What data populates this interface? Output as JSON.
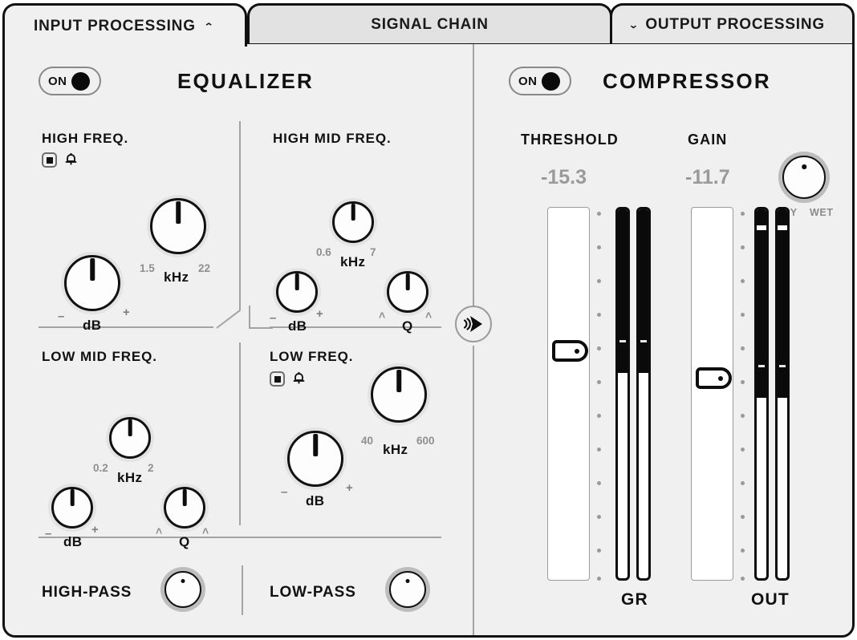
{
  "tabs": [
    {
      "id": "input",
      "label": "INPUT PROCESSING",
      "caret": "up",
      "state": "active"
    },
    {
      "id": "signal",
      "label": "SIGNAL CHAIN",
      "caret": "none",
      "state": "inactive"
    },
    {
      "id": "output",
      "label": "OUTPUT PROCESSING",
      "caret": "down",
      "state": "inactive"
    }
  ],
  "equalizer": {
    "title": "EQUALIZER",
    "power": {
      "label": "ON",
      "state": "on"
    },
    "bands": [
      {
        "id": "high",
        "label": "HIGH FREQ.",
        "filter_icons": [
          "shelf-icon",
          "bell-icon"
        ],
        "gain": {
          "unit": "dB",
          "minus": "–",
          "plus": "+"
        },
        "freq": {
          "unit": "kHz",
          "min": "1.5",
          "max": "22"
        }
      },
      {
        "id": "high-mid",
        "label": "HIGH MID FREQ.",
        "filter_icons": [],
        "gain": {
          "unit": "dB",
          "minus": "–",
          "plus": "+"
        },
        "freq": {
          "unit": "kHz",
          "min": "0.6",
          "max": "7"
        },
        "q": {
          "unit": "Q",
          "min": "˄",
          "max": "˄"
        }
      },
      {
        "id": "low-mid",
        "label": "LOW MID FREQ.",
        "filter_icons": [],
        "gain": {
          "unit": "dB",
          "minus": "–",
          "plus": "+"
        },
        "freq": {
          "unit": "kHz",
          "min": "0.2",
          "max": "2"
        },
        "q": {
          "unit": "Q",
          "min": "˄",
          "max": "˄"
        }
      },
      {
        "id": "low",
        "label": "LOW FREQ.",
        "filter_icons": [
          "shelf-icon",
          "bell-icon"
        ],
        "gain": {
          "unit": "dB",
          "minus": "–",
          "plus": "+"
        },
        "freq": {
          "unit": "kHz",
          "min": "40",
          "max": "600"
        }
      }
    ],
    "filters": [
      {
        "id": "high-pass",
        "label": "HIGH-PASS"
      },
      {
        "id": "low-pass",
        "label": "LOW-PASS"
      }
    ]
  },
  "flow_icon": "signal-flow-icon",
  "compressor": {
    "title": "COMPRESSOR",
    "power": {
      "label": "ON",
      "state": "on"
    },
    "threshold": {
      "label": "THRESHOLD",
      "value": "-15.3"
    },
    "gain": {
      "label": "GAIN",
      "value": "-11.7"
    },
    "drywet": {
      "dry": "DRY",
      "wet": "WET"
    },
    "meters": [
      {
        "id": "gr",
        "label": "GR"
      },
      {
        "id": "out",
        "label": "OUT"
      }
    ]
  },
  "colors": {
    "panel_bg": "#f0f0f0",
    "tab_inactive_bg": "#e2e2e2",
    "ink": "#111111",
    "muted": "#9a9a9a",
    "divider": "#a3a3a3",
    "knob_shadow": "#e3e3e3"
  }
}
